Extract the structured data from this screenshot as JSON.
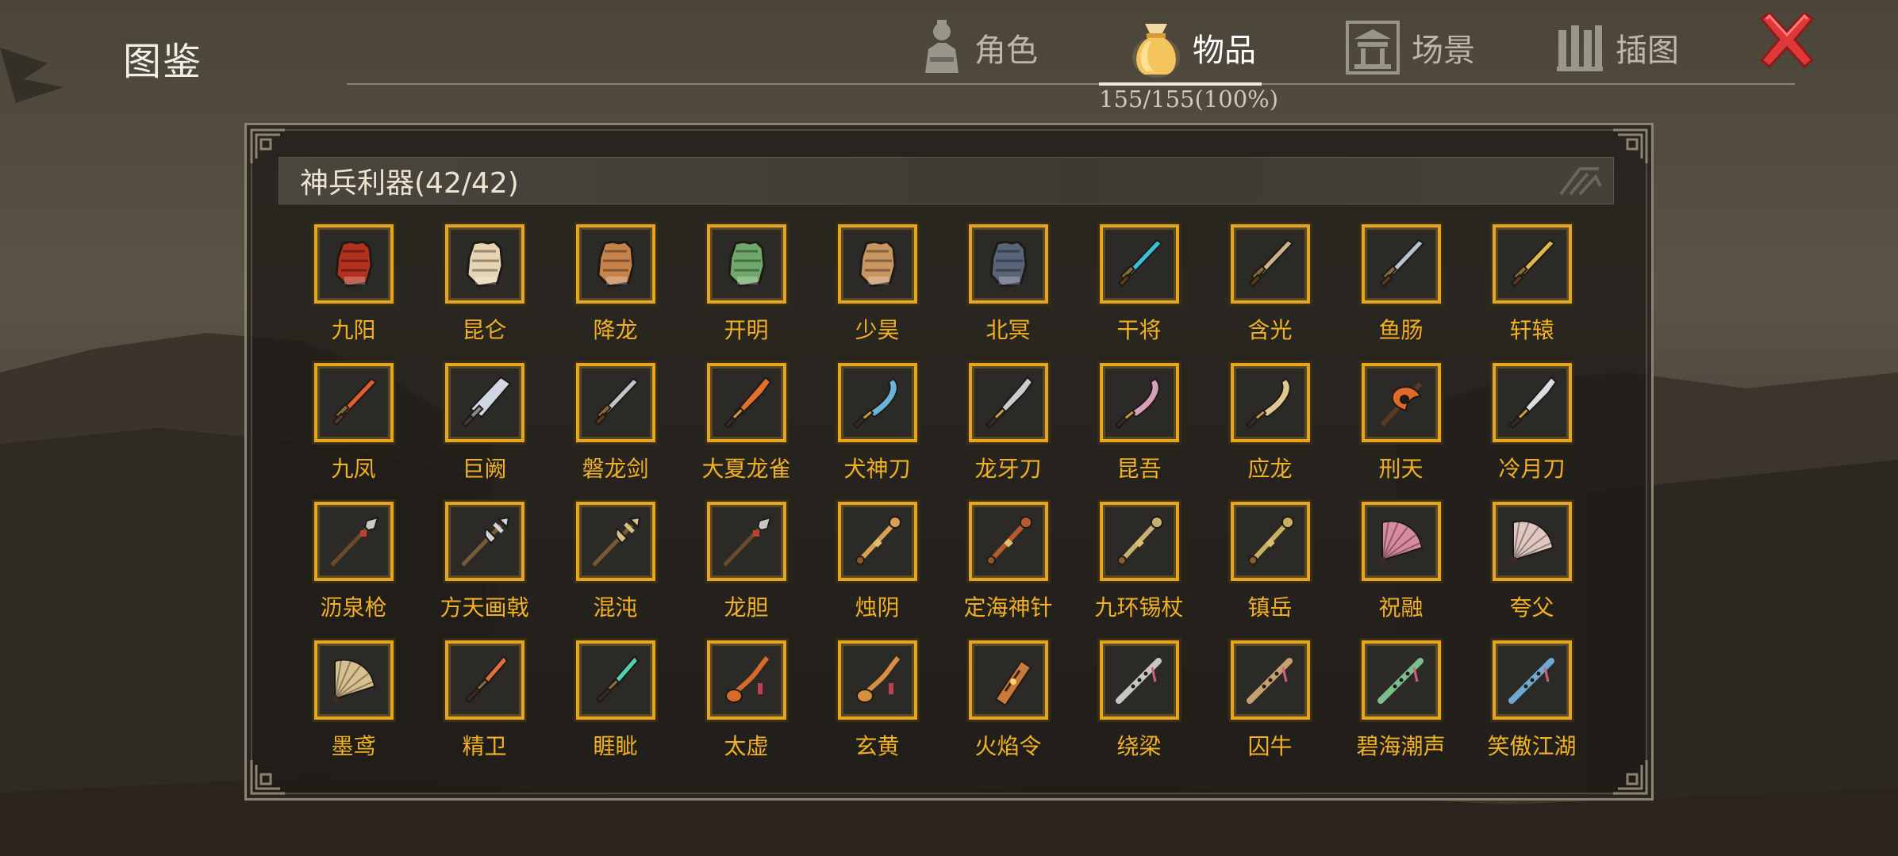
{
  "header": {
    "title": "图鉴",
    "progress": "155/155(100%)",
    "tabs": [
      {
        "label": "角色",
        "icon": "character-icon",
        "active": false
      },
      {
        "label": "物品",
        "icon": "money-bag-icon",
        "active": true
      },
      {
        "label": "场景",
        "icon": "pavilion-icon",
        "active": false
      },
      {
        "label": "插图",
        "icon": "illustration-icon",
        "active": false
      }
    ],
    "close_icon": "close-icon"
  },
  "category": {
    "title": "神兵利器(42/42)"
  },
  "items": [
    {
      "name": "九阳",
      "icon": "gauntlet-icon",
      "color": "#b3311f"
    },
    {
      "name": "昆仑",
      "icon": "gauntlet-icon",
      "color": "#e6d4b2"
    },
    {
      "name": "降龙",
      "icon": "gauntlet-icon",
      "color": "#c8834a"
    },
    {
      "name": "开明",
      "icon": "gauntlet-icon",
      "color": "#6fa86a"
    },
    {
      "name": "少昊",
      "icon": "gauntlet-icon",
      "color": "#c99560"
    },
    {
      "name": "北冥",
      "icon": "gauntlet-icon",
      "color": "#5a6478"
    },
    {
      "name": "干将",
      "icon": "sword-icon",
      "color": "#38c0d8"
    },
    {
      "name": "含光",
      "icon": "sword-icon",
      "color": "#c9b48a"
    },
    {
      "name": "鱼肠",
      "icon": "sword-icon",
      "color": "#b8c4d6"
    },
    {
      "name": "轩辕",
      "icon": "sword-icon",
      "color": "#e0b84a"
    },
    {
      "name": "九凤",
      "icon": "sword-icon",
      "color": "#e0602a"
    },
    {
      "name": "巨阙",
      "icon": "broadsword-icon",
      "color": "#cfd8e2"
    },
    {
      "name": "磐龙剑",
      "icon": "sword-icon",
      "color": "#c0c6cc"
    },
    {
      "name": "大夏龙雀",
      "icon": "blade-icon",
      "color": "#e0702a"
    },
    {
      "name": "犬神刀",
      "icon": "curved-blade-icon",
      "color": "#6ab4d8"
    },
    {
      "name": "龙牙刀",
      "icon": "blade-icon",
      "color": "#c8ccd2"
    },
    {
      "name": "昆吾",
      "icon": "curved-blade-icon",
      "color": "#d8a0b8"
    },
    {
      "name": "应龙",
      "icon": "curved-blade-icon",
      "color": "#e0c890"
    },
    {
      "name": "刑天",
      "icon": "axe-icon",
      "color": "#e06a2a"
    },
    {
      "name": "冷月刀",
      "icon": "blade-icon",
      "color": "#d8dde2"
    },
    {
      "name": "沥泉枪",
      "icon": "spear-icon",
      "color": "#c8c8c8"
    },
    {
      "name": "方天画戟",
      "icon": "halberd-icon",
      "color": "#d0d4da"
    },
    {
      "name": "混沌",
      "icon": "halberd-icon",
      "color": "#d8c080"
    },
    {
      "name": "龙胆",
      "icon": "spear-icon",
      "color": "#c4c4c4"
    },
    {
      "name": "烛阴",
      "icon": "staff-icon",
      "color": "#d8a050"
    },
    {
      "name": "定海神针",
      "icon": "staff-icon",
      "color": "#b85a2a"
    },
    {
      "name": "九环锡杖",
      "icon": "staff-icon",
      "color": "#c8b070"
    },
    {
      "name": "镇岳",
      "icon": "staff-icon",
      "color": "#c8b060"
    },
    {
      "name": "祝融",
      "icon": "fan-icon",
      "color": "#d88aa0"
    },
    {
      "name": "夸父",
      "icon": "fan-icon",
      "color": "#e0c8c0"
    },
    {
      "name": "墨鸢",
      "icon": "fan-icon",
      "color": "#d8c090"
    },
    {
      "name": "精卫",
      "icon": "dagger-icon",
      "color": "#e0703a"
    },
    {
      "name": "睚眦",
      "icon": "dagger-icon",
      "color": "#50d0b0"
    },
    {
      "name": "太虚",
      "icon": "whip-icon",
      "color": "#d86a2a"
    },
    {
      "name": "玄黄",
      "icon": "whip-icon",
      "color": "#d89040"
    },
    {
      "name": "火焰令",
      "icon": "token-icon",
      "color": "#c87a3a"
    },
    {
      "name": "绕梁",
      "icon": "flute-icon",
      "color": "#c8c8c0"
    },
    {
      "name": "囚牛",
      "icon": "flute-icon",
      "color": "#c8a070"
    },
    {
      "name": "碧海潮声",
      "icon": "flute-icon",
      "color": "#7ac08a"
    },
    {
      "name": "笑傲江湖",
      "icon": "flute-icon",
      "color": "#70a8d0"
    }
  ]
}
